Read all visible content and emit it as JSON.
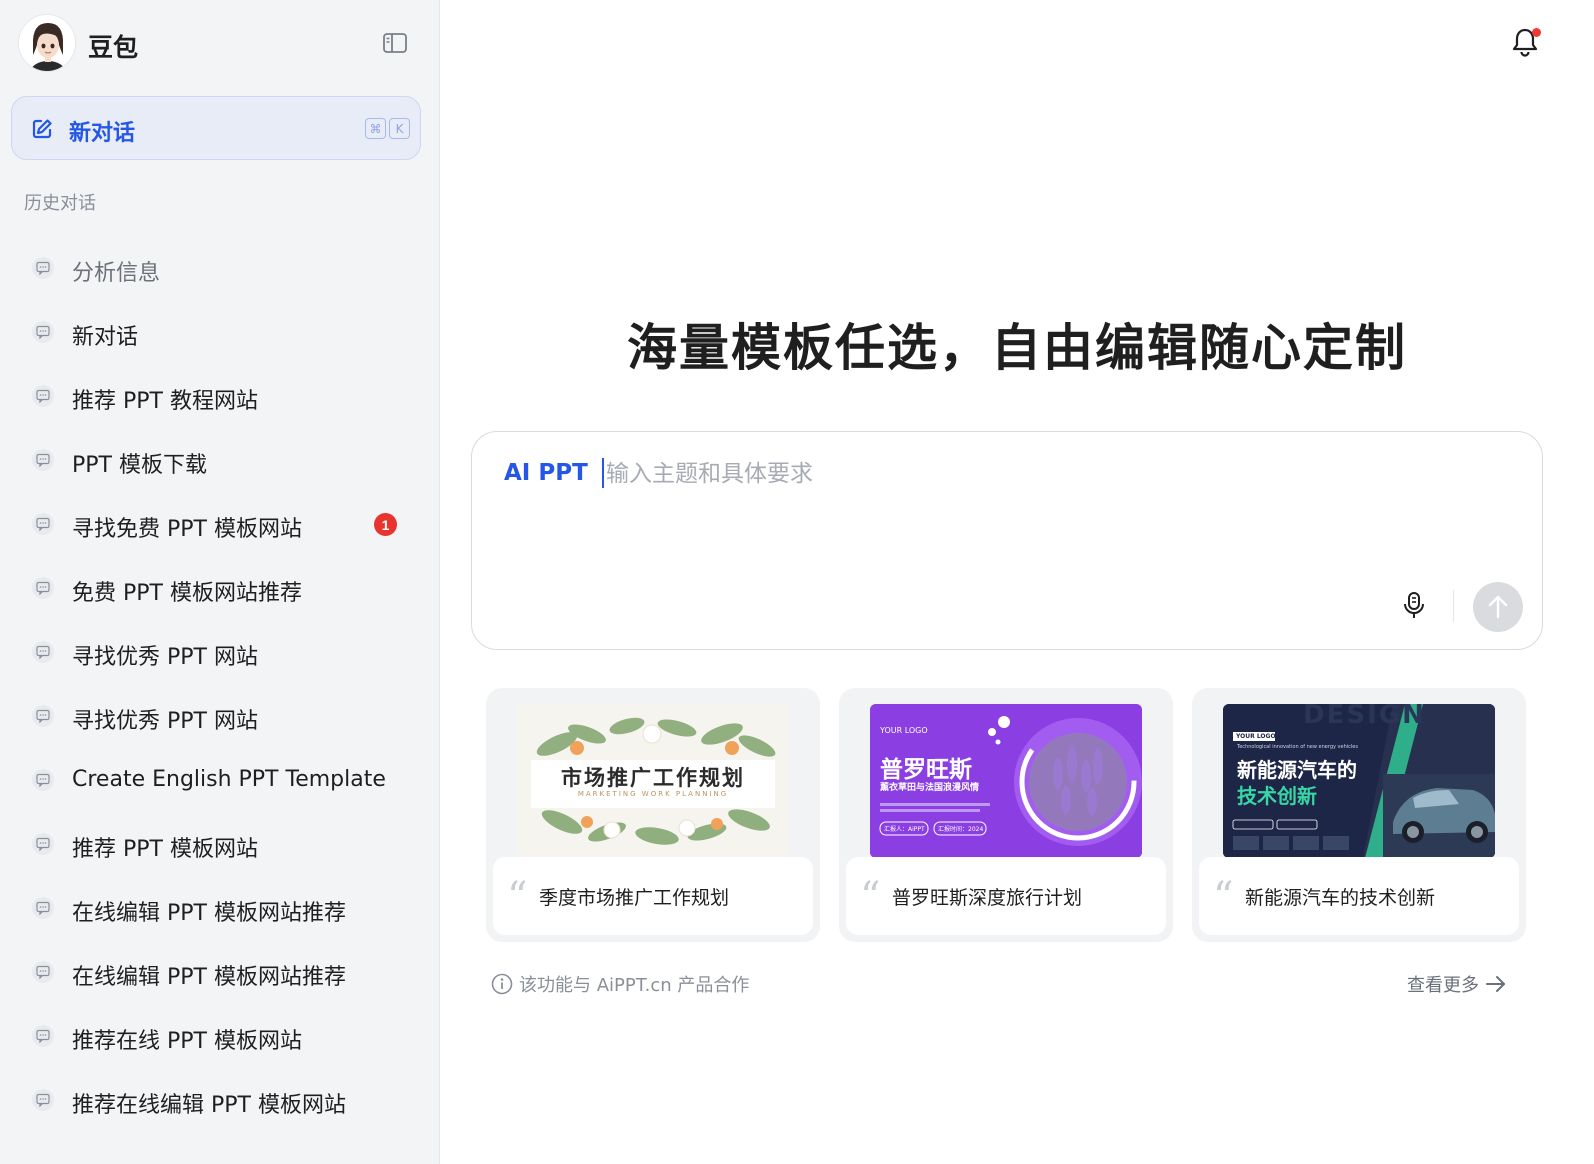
{
  "sidebar": {
    "app_title": "豆包",
    "new_chat_label": "新对话",
    "shortcut_keys": [
      "⌘",
      "K"
    ],
    "history_heading": "历史对话",
    "items": [
      {
        "label": "分析信息"
      },
      {
        "label": "新对话"
      },
      {
        "label": "推荐 PPT 教程网站"
      },
      {
        "label": "PPT 模板下载"
      },
      {
        "label": "寻找免费 PPT 模板网站",
        "badge": "1"
      },
      {
        "label": "免费 PPT 模板网站推荐"
      },
      {
        "label": "寻找优秀 PPT 网站"
      },
      {
        "label": "寻找优秀 PPT 网站"
      },
      {
        "label": "Create English PPT Template"
      },
      {
        "label": "推荐 PPT 模板网站"
      },
      {
        "label": "在线编辑 PPT 模板网站推荐"
      },
      {
        "label": "在线编辑 PPT 模板网站推荐"
      },
      {
        "label": "推荐在线 PPT 模板网站"
      },
      {
        "label": "推荐在线编辑 PPT 模板网站"
      }
    ]
  },
  "header": {
    "notification_icon": "bell-icon",
    "has_unread": true
  },
  "main": {
    "title": "海量模板任选，自由编辑随心定制",
    "composer": {
      "mode_label": "AI PPT",
      "placeholder": "输入主题和具体要求",
      "value": ""
    },
    "templates": [
      {
        "caption": "季度市场推广工作规划",
        "thumb_title": "市场推广工作规划",
        "thumb_subtitle": "MARKETING WORK PLANNING"
      },
      {
        "caption": "普罗旺斯深度旅行计划",
        "thumb_logo": "YOUR LOGO",
        "thumb_title": "普罗旺斯",
        "thumb_subtitle": "薰衣草田与法国浪漫风情",
        "thumb_tag1": "汇报人：AiPPT",
        "thumb_tag2": "汇报时间：2024"
      },
      {
        "caption": "新能源汽车的技术创新",
        "thumb_logo": "YOUR LOGO",
        "thumb_en": "Technological innovation of new energy vehicles",
        "thumb_title_line1": "新能源汽车的",
        "thumb_title_line2": "技术创新",
        "thumb_bg_word": "DESIGN"
      }
    ],
    "footnote": "该功能与 AiPPT.cn 产品合作",
    "see_more": "查看更多"
  },
  "colors": {
    "accent": "#2457e6",
    "sidebar_bg": "#f3f4f6",
    "badge": "#e8332e",
    "provence_purple": "#8a3fe0",
    "car_teal": "#1f7a6a"
  }
}
